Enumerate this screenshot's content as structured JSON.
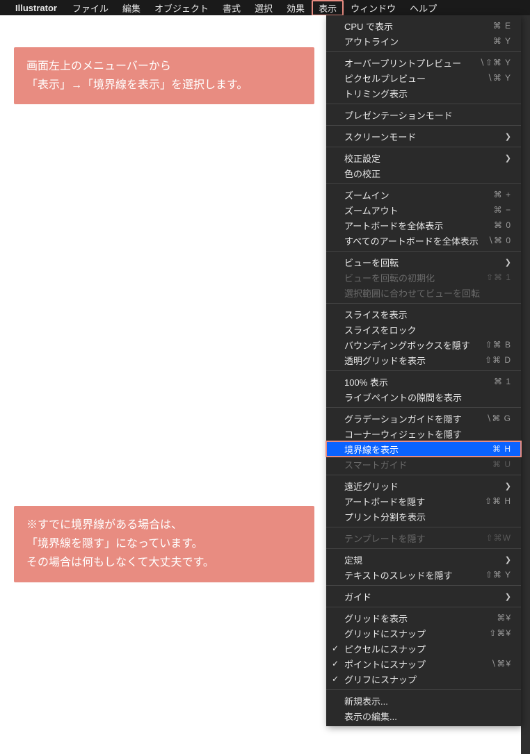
{
  "menubar": {
    "app_name": "Illustrator",
    "items": [
      "ファイル",
      "編集",
      "オブジェクト",
      "書式",
      "選択",
      "効果",
      "表示",
      "ウィンドウ",
      "ヘルプ"
    ],
    "highlighted_index": 6
  },
  "annotations": {
    "a1_line1": "画面左上のメニューバーから",
    "a1_line2": "「表示」→「境界線を表示」を選択します。",
    "a2_line1": "※すでに境界線がある場合は、",
    "a2_line2": "「境界線を隠す」になっています。",
    "a2_line3": "その場合は何もしなくて大丈夫です。"
  },
  "dropdown": [
    {
      "type": "item",
      "label": "CPU で表示",
      "shortcut": "⌘ E"
    },
    {
      "type": "item",
      "label": "アウトライン",
      "shortcut": "⌘ Y"
    },
    {
      "type": "sep"
    },
    {
      "type": "item",
      "label": "オーバープリントプレビュー",
      "shortcut": "∖⇧⌘ Y"
    },
    {
      "type": "item",
      "label": "ピクセルプレビュー",
      "shortcut": "∖⌘ Y"
    },
    {
      "type": "item",
      "label": "トリミング表示"
    },
    {
      "type": "sep"
    },
    {
      "type": "item",
      "label": "プレゼンテーションモード"
    },
    {
      "type": "sep"
    },
    {
      "type": "item",
      "label": "スクリーンモード",
      "submenu": true
    },
    {
      "type": "sep"
    },
    {
      "type": "item",
      "label": "校正設定",
      "submenu": true
    },
    {
      "type": "item",
      "label": "色の校正"
    },
    {
      "type": "sep"
    },
    {
      "type": "item",
      "label": "ズームイン",
      "shortcut": "⌘ +"
    },
    {
      "type": "item",
      "label": "ズームアウト",
      "shortcut": "⌘ −"
    },
    {
      "type": "item",
      "label": "アートボードを全体表示",
      "shortcut": "⌘ 0"
    },
    {
      "type": "item",
      "label": "すべてのアートボードを全体表示",
      "shortcut": "∖⌘ 0"
    },
    {
      "type": "sep"
    },
    {
      "type": "item",
      "label": "ビューを回転",
      "submenu": true
    },
    {
      "type": "item",
      "label": "ビューを回転の初期化",
      "shortcut": "⇧⌘ 1",
      "disabled": true
    },
    {
      "type": "item",
      "label": "選択範囲に合わせてビューを回転",
      "disabled": true
    },
    {
      "type": "sep"
    },
    {
      "type": "item",
      "label": "スライスを表示"
    },
    {
      "type": "item",
      "label": "スライスをロック"
    },
    {
      "type": "item",
      "label": "バウンディングボックスを隠す",
      "shortcut": "⇧⌘ B"
    },
    {
      "type": "item",
      "label": "透明グリッドを表示",
      "shortcut": "⇧⌘ D"
    },
    {
      "type": "sep"
    },
    {
      "type": "item",
      "label": "100% 表示",
      "shortcut": "⌘ 1"
    },
    {
      "type": "item",
      "label": "ライブペイントの隙間を表示"
    },
    {
      "type": "sep"
    },
    {
      "type": "item",
      "label": "グラデーションガイドを隠す",
      "shortcut": "∖⌘ G"
    },
    {
      "type": "item",
      "label": "コーナーウィジェットを隠す"
    },
    {
      "type": "item",
      "label": "境界線を表示",
      "shortcut": "⌘ H",
      "selected": true,
      "highlighted": true
    },
    {
      "type": "item",
      "label": "スマートガイド",
      "shortcut": "⌘ U",
      "disabled": true
    },
    {
      "type": "sep"
    },
    {
      "type": "item",
      "label": "遠近グリッド",
      "submenu": true
    },
    {
      "type": "item",
      "label": "アートボードを隠す",
      "shortcut": "⇧⌘ H"
    },
    {
      "type": "item",
      "label": "プリント分割を表示"
    },
    {
      "type": "sep"
    },
    {
      "type": "item",
      "label": "テンプレートを隠す",
      "shortcut": "⇧⌘W",
      "disabled": true
    },
    {
      "type": "sep"
    },
    {
      "type": "item",
      "label": "定規",
      "submenu": true
    },
    {
      "type": "item",
      "label": "テキストのスレッドを隠す",
      "shortcut": "⇧⌘ Y"
    },
    {
      "type": "sep"
    },
    {
      "type": "item",
      "label": "ガイド",
      "submenu": true
    },
    {
      "type": "sep"
    },
    {
      "type": "item",
      "label": "グリッドを表示",
      "shortcut": "⌘¥"
    },
    {
      "type": "item",
      "label": "グリッドにスナップ",
      "shortcut": "⇧⌘¥"
    },
    {
      "type": "item",
      "label": "ピクセルにスナップ",
      "checked": true
    },
    {
      "type": "item",
      "label": "ポイントにスナップ",
      "shortcut": "∖⌘¥",
      "checked": true
    },
    {
      "type": "item",
      "label": "グリフにスナップ",
      "checked": true
    },
    {
      "type": "sep"
    },
    {
      "type": "item",
      "label": "新規表示..."
    },
    {
      "type": "item",
      "label": "表示の編集..."
    }
  ]
}
